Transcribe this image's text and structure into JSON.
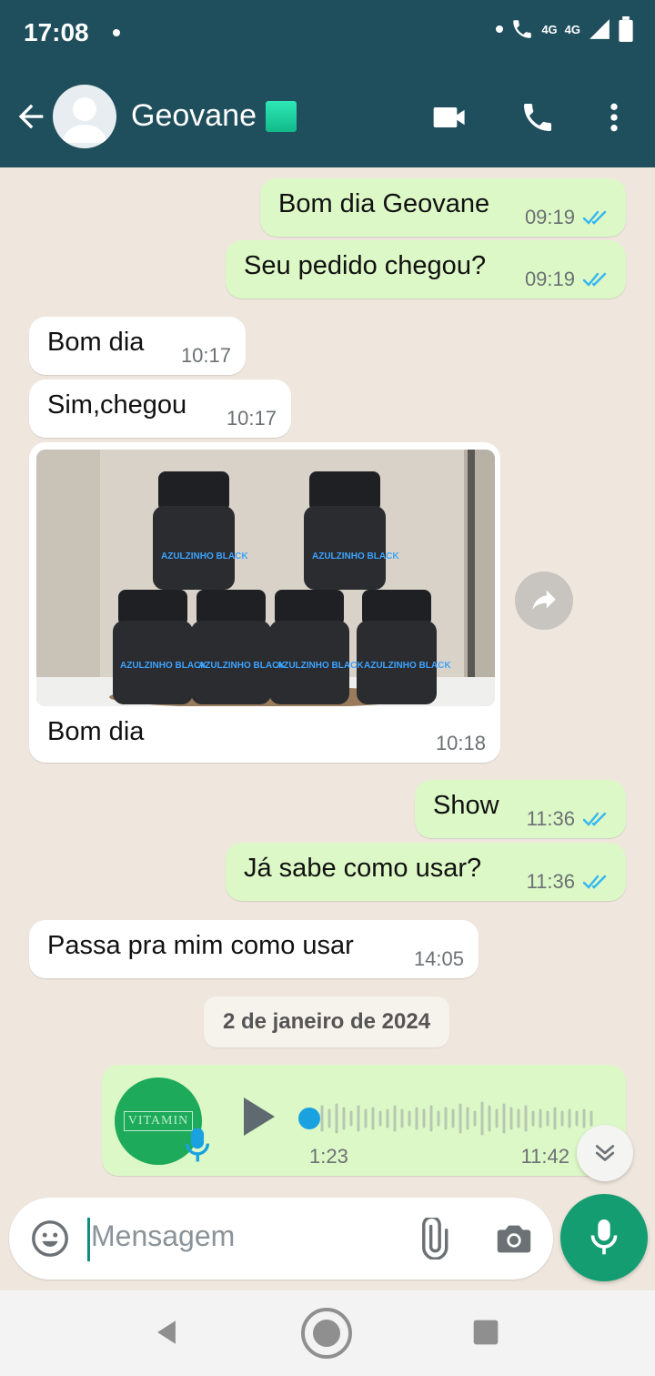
{
  "status_bar": {
    "time": "17:08",
    "network_1": "4G",
    "network_2": "4G"
  },
  "header": {
    "contact_name": "Geovane",
    "back_icon": "arrow-left-icon",
    "video_icon": "video-camera-icon",
    "call_icon": "phone-icon",
    "menu_icon": "more-vert-icon"
  },
  "messages": [
    {
      "dir": "out",
      "text": "Bom dia Geovane",
      "time": "09:19",
      "status": "read"
    },
    {
      "dir": "out",
      "text": "Seu pedido chegou?",
      "time": "09:19",
      "status": "read"
    },
    {
      "dir": "in",
      "text": "Bom dia",
      "time": "10:17"
    },
    {
      "dir": "in",
      "text": "Sim,chegou",
      "time": "10:17"
    },
    {
      "dir": "in",
      "type": "image",
      "caption": "Bom dia",
      "time": "10:18",
      "image_label": "AZULZINHO BLACK"
    },
    {
      "dir": "out",
      "text": "Show",
      "time": "11:36",
      "status": "read"
    },
    {
      "dir": "out",
      "text": "Já sabe como usar?",
      "time": "11:36",
      "status": "read"
    },
    {
      "dir": "in",
      "text": "Passa pra mim como usar",
      "time": "14:05"
    }
  ],
  "date_separator": "2 de janeiro de 2024",
  "voice_message": {
    "avatar_label": "VITAMIN",
    "duration": "1:23",
    "time": "11:42",
    "status": "read",
    "progress": 0.0
  },
  "composer": {
    "placeholder": "Mensagem"
  },
  "colors": {
    "header": "#1f4f5c",
    "outgoing": "#dcf8c6",
    "incoming": "#ffffff",
    "accent": "#159d72",
    "ticks": "#34b7f1"
  }
}
